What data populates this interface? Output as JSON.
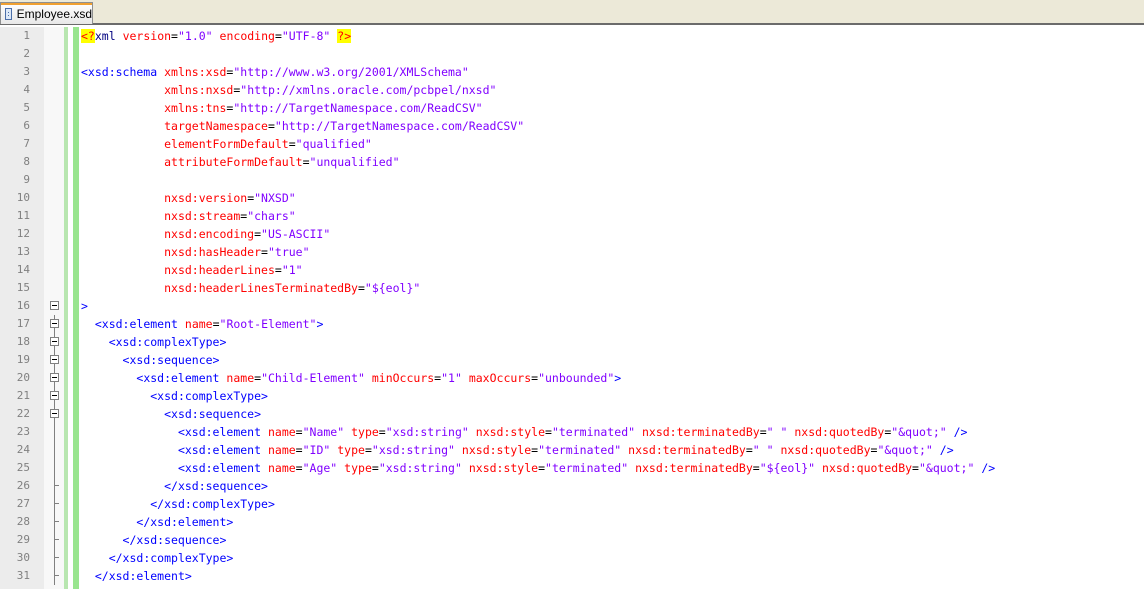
{
  "tab": {
    "title": "Employee.xsd"
  },
  "lines": [
    {
      "num": "1",
      "segs": [
        [
          "pi",
          "<?"
        ],
        [
          "pn",
          "xml"
        ],
        [
          "tx",
          " "
        ],
        [
          "at",
          "version"
        ],
        [
          "eq",
          "="
        ],
        [
          "vl",
          "\"1.0\""
        ],
        [
          "tx",
          " "
        ],
        [
          "at",
          "encoding"
        ],
        [
          "eq",
          "="
        ],
        [
          "vl",
          "\"UTF-8\""
        ],
        [
          "tx",
          " "
        ],
        [
          "pi",
          "?>"
        ]
      ]
    },
    {
      "num": "2",
      "segs": []
    },
    {
      "num": "3",
      "segs": [
        [
          "tg",
          "<xsd:schema"
        ],
        [
          "tx",
          " "
        ],
        [
          "at",
          "xmlns:xsd"
        ],
        [
          "eq",
          "="
        ],
        [
          "vl",
          "\"http://www.w3.org/2001/XMLSchema\""
        ]
      ]
    },
    {
      "num": "4",
      "segs": [
        [
          "tx",
          "            "
        ],
        [
          "at",
          "xmlns:nxsd"
        ],
        [
          "eq",
          "="
        ],
        [
          "vl",
          "\"http://xmlns.oracle.com/pcbpel/nxsd\""
        ]
      ]
    },
    {
      "num": "5",
      "segs": [
        [
          "tx",
          "            "
        ],
        [
          "at",
          "xmlns:tns"
        ],
        [
          "eq",
          "="
        ],
        [
          "vl",
          "\"http://TargetNamespace.com/ReadCSV\""
        ]
      ]
    },
    {
      "num": "6",
      "segs": [
        [
          "tx",
          "            "
        ],
        [
          "at",
          "targetNamespace"
        ],
        [
          "eq",
          "="
        ],
        [
          "vl",
          "\"http://TargetNamespace.com/ReadCSV\""
        ]
      ]
    },
    {
      "num": "7",
      "segs": [
        [
          "tx",
          "            "
        ],
        [
          "at",
          "elementFormDefault"
        ],
        [
          "eq",
          "="
        ],
        [
          "vl",
          "\"qualified\""
        ]
      ]
    },
    {
      "num": "8",
      "segs": [
        [
          "tx",
          "            "
        ],
        [
          "at",
          "attributeFormDefault"
        ],
        [
          "eq",
          "="
        ],
        [
          "vl",
          "\"unqualified\""
        ]
      ]
    },
    {
      "num": "9",
      "segs": []
    },
    {
      "num": "10",
      "segs": [
        [
          "tx",
          "            "
        ],
        [
          "at",
          "nxsd:version"
        ],
        [
          "eq",
          "="
        ],
        [
          "vl",
          "\"NXSD\""
        ]
      ]
    },
    {
      "num": "11",
      "segs": [
        [
          "tx",
          "            "
        ],
        [
          "at",
          "nxsd:stream"
        ],
        [
          "eq",
          "="
        ],
        [
          "vl",
          "\"chars\""
        ]
      ]
    },
    {
      "num": "12",
      "segs": [
        [
          "tx",
          "            "
        ],
        [
          "at",
          "nxsd:encoding"
        ],
        [
          "eq",
          "="
        ],
        [
          "vl",
          "\"US-ASCII\""
        ]
      ]
    },
    {
      "num": "13",
      "segs": [
        [
          "tx",
          "            "
        ],
        [
          "at",
          "nxsd:hasHeader"
        ],
        [
          "eq",
          "="
        ],
        [
          "vl",
          "\"true\""
        ]
      ]
    },
    {
      "num": "14",
      "segs": [
        [
          "tx",
          "            "
        ],
        [
          "at",
          "nxsd:headerLines"
        ],
        [
          "eq",
          "="
        ],
        [
          "vl",
          "\"1\""
        ]
      ]
    },
    {
      "num": "15",
      "segs": [
        [
          "tx",
          "            "
        ],
        [
          "at",
          "nxsd:headerLinesTerminatedBy"
        ],
        [
          "eq",
          "="
        ],
        [
          "vl",
          "\"${eol}\""
        ]
      ]
    },
    {
      "num": "16",
      "segs": [
        [
          "tg",
          ">"
        ]
      ]
    },
    {
      "num": "17",
      "segs": [
        [
          "tx",
          "  "
        ],
        [
          "tg",
          "<xsd:element"
        ],
        [
          "tx",
          " "
        ],
        [
          "at",
          "name"
        ],
        [
          "eq",
          "="
        ],
        [
          "vl",
          "\"Root-Element\""
        ],
        [
          "tg",
          ">"
        ]
      ]
    },
    {
      "num": "18",
      "segs": [
        [
          "tx",
          "    "
        ],
        [
          "tg",
          "<xsd:complexType>"
        ]
      ]
    },
    {
      "num": "19",
      "segs": [
        [
          "tx",
          "      "
        ],
        [
          "tg",
          "<xsd:sequence>"
        ]
      ]
    },
    {
      "num": "20",
      "segs": [
        [
          "tx",
          "        "
        ],
        [
          "tg",
          "<xsd:element"
        ],
        [
          "tx",
          " "
        ],
        [
          "at",
          "name"
        ],
        [
          "eq",
          "="
        ],
        [
          "vl",
          "\"Child-Element\""
        ],
        [
          "tx",
          " "
        ],
        [
          "at",
          "minOccurs"
        ],
        [
          "eq",
          "="
        ],
        [
          "vl",
          "\"1\""
        ],
        [
          "tx",
          " "
        ],
        [
          "at",
          "maxOccurs"
        ],
        [
          "eq",
          "="
        ],
        [
          "vl",
          "\"unbounded\""
        ],
        [
          "tg",
          ">"
        ]
      ]
    },
    {
      "num": "21",
      "segs": [
        [
          "tx",
          "          "
        ],
        [
          "tg",
          "<xsd:complexType>"
        ]
      ]
    },
    {
      "num": "22",
      "segs": [
        [
          "tx",
          "            "
        ],
        [
          "tg",
          "<xsd:sequence>"
        ]
      ]
    },
    {
      "num": "23",
      "segs": [
        [
          "tx",
          "              "
        ],
        [
          "tg",
          "<xsd:element"
        ],
        [
          "tx",
          " "
        ],
        [
          "at",
          "name"
        ],
        [
          "eq",
          "="
        ],
        [
          "vl",
          "\"Name\""
        ],
        [
          "tx",
          " "
        ],
        [
          "at",
          "type"
        ],
        [
          "eq",
          "="
        ],
        [
          "vl",
          "\"xsd:string\""
        ],
        [
          "tx",
          " "
        ],
        [
          "at",
          "nxsd:style"
        ],
        [
          "eq",
          "="
        ],
        [
          "vl",
          "\"terminated\""
        ],
        [
          "tx",
          " "
        ],
        [
          "at",
          "nxsd:terminatedBy"
        ],
        [
          "eq",
          "="
        ],
        [
          "vl",
          "\" \""
        ],
        [
          "tx",
          " "
        ],
        [
          "at",
          "nxsd:quotedBy"
        ],
        [
          "eq",
          "="
        ],
        [
          "vl",
          "\"&quot;\""
        ],
        [
          "tx",
          " "
        ],
        [
          "tg",
          "/>"
        ]
      ]
    },
    {
      "num": "24",
      "segs": [
        [
          "tx",
          "              "
        ],
        [
          "tg",
          "<xsd:element"
        ],
        [
          "tx",
          " "
        ],
        [
          "at",
          "name"
        ],
        [
          "eq",
          "="
        ],
        [
          "vl",
          "\"ID\""
        ],
        [
          "tx",
          " "
        ],
        [
          "at",
          "type"
        ],
        [
          "eq",
          "="
        ],
        [
          "vl",
          "\"xsd:string\""
        ],
        [
          "tx",
          " "
        ],
        [
          "at",
          "nxsd:style"
        ],
        [
          "eq",
          "="
        ],
        [
          "vl",
          "\"terminated\""
        ],
        [
          "tx",
          " "
        ],
        [
          "at",
          "nxsd:terminatedBy"
        ],
        [
          "eq",
          "="
        ],
        [
          "vl",
          "\" \""
        ],
        [
          "tx",
          " "
        ],
        [
          "at",
          "nxsd:quotedBy"
        ],
        [
          "eq",
          "="
        ],
        [
          "vl",
          "\"&quot;\""
        ],
        [
          "tx",
          " "
        ],
        [
          "tg",
          "/>"
        ]
      ]
    },
    {
      "num": "25",
      "segs": [
        [
          "tx",
          "              "
        ],
        [
          "tg",
          "<xsd:element"
        ],
        [
          "tx",
          " "
        ],
        [
          "at",
          "name"
        ],
        [
          "eq",
          "="
        ],
        [
          "vl",
          "\"Age\""
        ],
        [
          "tx",
          " "
        ],
        [
          "at",
          "type"
        ],
        [
          "eq",
          "="
        ],
        [
          "vl",
          "\"xsd:string\""
        ],
        [
          "tx",
          " "
        ],
        [
          "at",
          "nxsd:style"
        ],
        [
          "eq",
          "="
        ],
        [
          "vl",
          "\"terminated\""
        ],
        [
          "tx",
          " "
        ],
        [
          "at",
          "nxsd:terminatedBy"
        ],
        [
          "eq",
          "="
        ],
        [
          "vl",
          "\"${eol}\""
        ],
        [
          "tx",
          " "
        ],
        [
          "at",
          "nxsd:quotedBy"
        ],
        [
          "eq",
          "="
        ],
        [
          "vl",
          "\"&quot;\""
        ],
        [
          "tx",
          " "
        ],
        [
          "tg",
          "/>"
        ]
      ]
    },
    {
      "num": "26",
      "segs": [
        [
          "tx",
          "            "
        ],
        [
          "tg",
          "</xsd:sequence>"
        ]
      ]
    },
    {
      "num": "27",
      "segs": [
        [
          "tx",
          "          "
        ],
        [
          "tg",
          "</xsd:complexType>"
        ]
      ]
    },
    {
      "num": "28",
      "segs": [
        [
          "tx",
          "        "
        ],
        [
          "tg",
          "</xsd:element>"
        ]
      ]
    },
    {
      "num": "29",
      "segs": [
        [
          "tx",
          "      "
        ],
        [
          "tg",
          "</xsd:sequence>"
        ]
      ]
    },
    {
      "num": "30",
      "segs": [
        [
          "tx",
          "    "
        ],
        [
          "tg",
          "</xsd:complexType>"
        ]
      ]
    },
    {
      "num": "31",
      "segs": [
        [
          "tx",
          "  "
        ],
        [
          "tg",
          "</xsd:element>"
        ]
      ]
    }
  ]
}
